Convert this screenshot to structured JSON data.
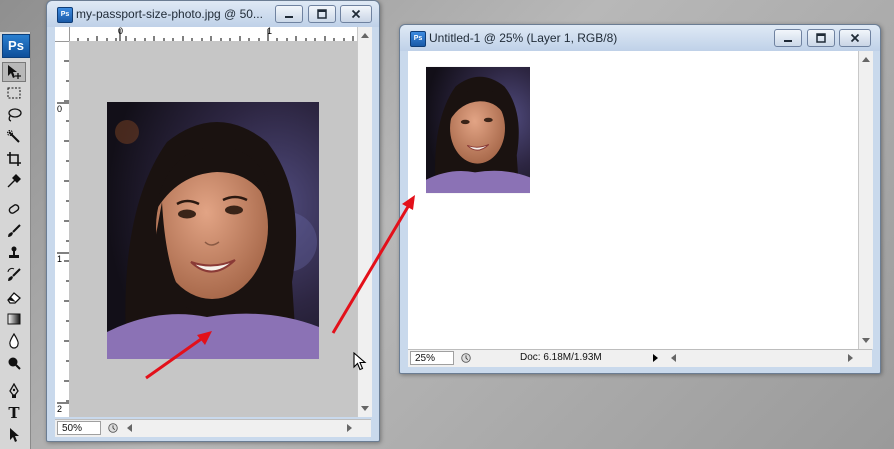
{
  "app": {
    "logo": "Ps",
    "tools": [
      "move-tool",
      "marquee-tool",
      "lasso-tool",
      "quick-select-tool",
      "crop-tool",
      "eyedropper-tool",
      "spot-heal-tool",
      "brush-tool",
      "clone-stamp-tool",
      "history-brush-tool",
      "eraser-tool",
      "gradient-tool",
      "blur-tool",
      "dodge-tool",
      "pen-tool",
      "type-tool",
      "path-select-tool"
    ],
    "type_tool_glyph": "T"
  },
  "window1": {
    "icon": "Ps",
    "title": "my-passport-size-photo.jpg @ 50...",
    "zoom": "50%",
    "ruler_h": [
      "0",
      "1"
    ],
    "ruler_v": [
      "0",
      "1",
      "2"
    ]
  },
  "window2": {
    "icon": "Ps",
    "title": "Untitled-1 @ 25% (Layer 1, RGB/8)",
    "zoom": "25%",
    "doc_info": "Doc: 6.18M/1.93M"
  },
  "colors": {
    "canvas_gray": "#c6c6c6",
    "annotation_arrow": "#e3101a",
    "shirt_purple": "#8b72b5"
  }
}
